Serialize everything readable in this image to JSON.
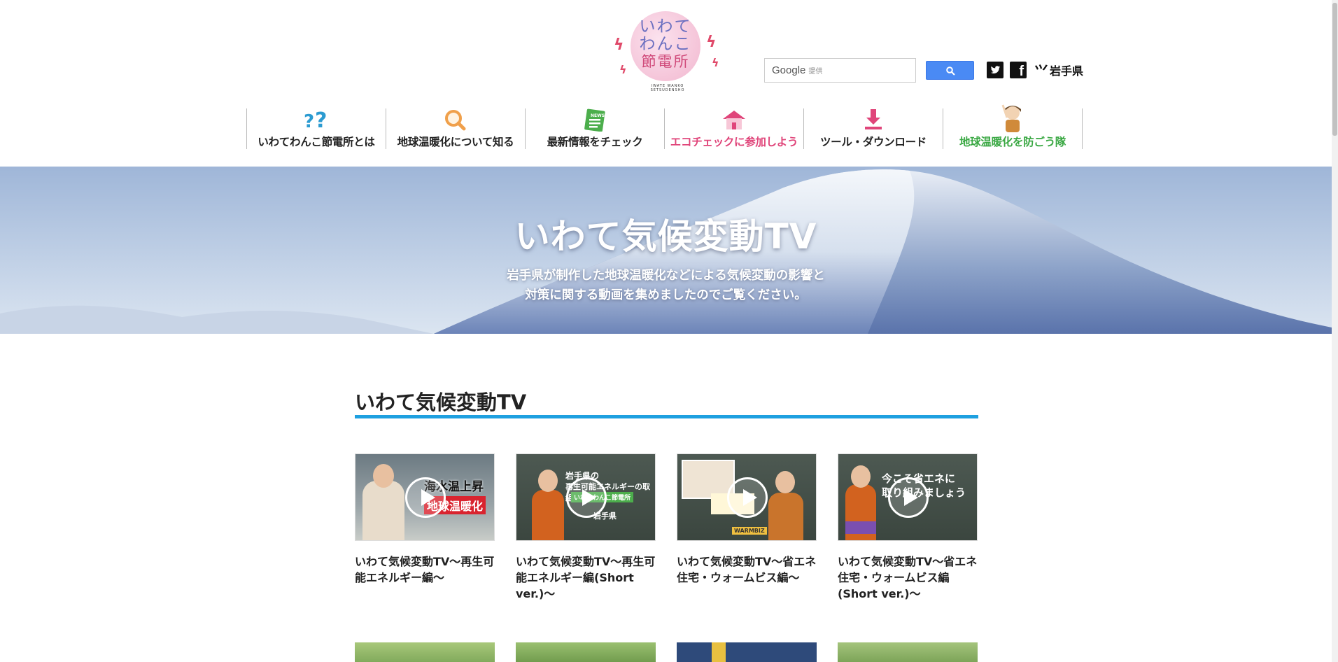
{
  "header": {
    "logo": {
      "line1": "いわて",
      "line2": "わんこ",
      "line3": "節電所",
      "sub": "IWATE WANKO SETSUDENSHO"
    },
    "search": {
      "brand": "Google",
      "small": "提供"
    },
    "pref_label": "岩手県",
    "pref_mark": "⺍"
  },
  "nav": [
    {
      "label": "いわてわんこ節電所とは",
      "icon": "question-icon",
      "color": "#222222"
    },
    {
      "label": "地球温暖化について知る",
      "icon": "magnifier-icon",
      "color": "#222222"
    },
    {
      "label": "最新情報をチェック",
      "icon": "news-icon",
      "color": "#222222"
    },
    {
      "label": "エコチェックに参加しよう",
      "icon": "house-icon",
      "color": "#e0457a"
    },
    {
      "label": "ツール・ダウンロード",
      "icon": "download-icon",
      "color": "#222222"
    },
    {
      "label": "地球温暖化を防ごう隊",
      "icon": "character-icon",
      "color": "#3aa843"
    }
  ],
  "hero": {
    "title": "いわて気候変動TV",
    "desc1": "岩手県が制作した地球温暖化などによる気候変動の影響と",
    "desc2": "対策に関する動画を集めましたのでご覧ください。"
  },
  "section": {
    "title": "いわて気候変動TV"
  },
  "videos": [
    {
      "title": "いわて気候変動TV～再生可能エネルギー編～",
      "cap1": "海水温上昇",
      "cap2": "地球温暖化"
    },
    {
      "title": "いわて気候変動TV～再生可能エネルギー編(Short ver.)～",
      "cap1": "岩手県の",
      "cap2": "再生可能エネルギーの取組は",
      "cap3": "いわてわんこ節電所",
      "cap4": "岩手県"
    },
    {
      "title": "いわて気候変動TV～省エネ住宅・ウォームビス編～",
      "cap1": "WARMBIZ"
    },
    {
      "title": "いわて気候変動TV～省エネ住宅・ウォームビス編(Short ver.)～",
      "cap1": "今こそ省エネに",
      "cap2": "取り組みましょう"
    }
  ],
  "colors": {
    "accent": "#1ea0e0",
    "search_button": "#4a8af4"
  }
}
